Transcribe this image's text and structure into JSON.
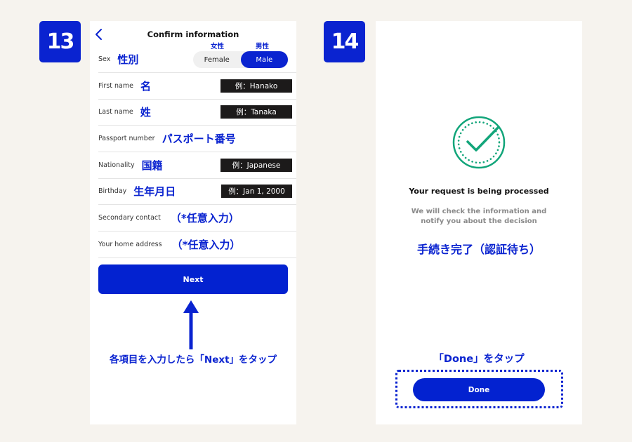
{
  "steps": [
    {
      "number": "13"
    },
    {
      "number": "14"
    }
  ],
  "screen13": {
    "title": "Confirm information",
    "back_icon": "chevron-left-icon",
    "sex": {
      "label": "Sex",
      "label_jp": "性別",
      "options": [
        {
          "label": "Female",
          "label_jp": "女性",
          "selected": false
        },
        {
          "label": "Male",
          "label_jp": "男性",
          "selected": true
        }
      ]
    },
    "fields": [
      {
        "label": "First name",
        "label_jp": "名",
        "example": "例：Hanako"
      },
      {
        "label": "Last name",
        "label_jp": "姓",
        "example": "例：Tanaka"
      },
      {
        "label": "Passport number",
        "label_jp": "パスポート番号",
        "example": null
      },
      {
        "label": "Nationality",
        "label_jp": "国籍",
        "example": "例：Japanese"
      },
      {
        "label": "Birthday",
        "label_jp": "生年月日",
        "example": "例：Jan 1, 2000"
      },
      {
        "label": "Secondary contact",
        "label_jp": "（*任意入力）",
        "example": null
      },
      {
        "label": "Your home address",
        "label_jp": "（*任意入力）",
        "example": null
      }
    ],
    "next_button": "Next",
    "instruction": "各項目を入力したら「Next」をタップ"
  },
  "screen14": {
    "status_icon": "check-circle-icon",
    "status_title": "Your request is being processed",
    "status_desc_line1": "We will check the information and",
    "status_desc_line2": "notify you about the decision",
    "status_jp": "手続き完了（認証待ち）",
    "instruction": "「Done」をタップ",
    "done_button": "Done"
  },
  "colors": {
    "accent": "#0a23d0",
    "button": "#0322d0",
    "success": "#12a57a",
    "background": "#f6f3ee",
    "example_box": "#1c1a1a"
  }
}
